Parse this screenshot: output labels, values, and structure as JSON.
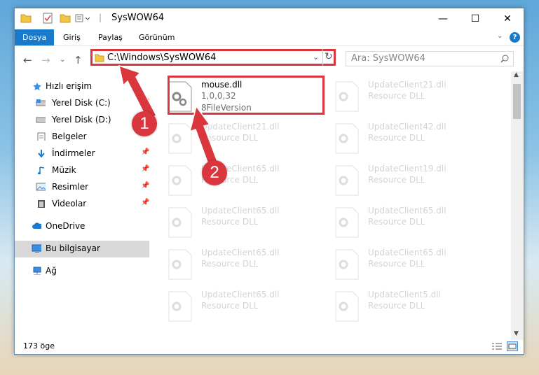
{
  "window": {
    "title": "SysWOW64",
    "controls": [
      "—",
      "☐",
      "✕"
    ]
  },
  "ribbon": {
    "tabs": [
      {
        "label": "Dosya",
        "active": true
      },
      {
        "label": "Giriş",
        "active": false
      },
      {
        "label": "Paylaş",
        "active": false
      },
      {
        "label": "Görünüm",
        "active": false
      }
    ],
    "help_icon": "help-icon"
  },
  "nav": {
    "address": "C:\\Windows\\SysWOW64",
    "search_placeholder": "Ara: SysWOW64"
  },
  "sidebar": {
    "items": [
      {
        "label": "Hızlı erişim",
        "icon": "star-icon",
        "pinned": false
      },
      {
        "label": "Yerel Disk (C:)",
        "icon": "drive-icon",
        "pinned": true
      },
      {
        "label": "Yerel Disk (D:)",
        "icon": "drive-icon",
        "pinned": false
      },
      {
        "label": "Belgeler",
        "icon": "documents-icon",
        "pinned": false
      },
      {
        "label": "İndirmeler",
        "icon": "download-icon",
        "pinned": true
      },
      {
        "label": "Müzik",
        "icon": "music-icon",
        "pinned": true
      },
      {
        "label": "Resimler",
        "icon": "pictures-icon",
        "pinned": true
      },
      {
        "label": "Videolar",
        "icon": "videos-icon",
        "pinned": true
      },
      {
        "label": "OneDrive",
        "icon": "cloud-icon",
        "pinned": false
      },
      {
        "label": "Bu bilgisayar",
        "icon": "computer-icon",
        "pinned": false,
        "selected": true
      },
      {
        "label": "Ağ",
        "icon": "network-icon",
        "pinned": false
      }
    ]
  },
  "files": [
    {
      "name": "mouse.dll",
      "type": "1,0,0,32",
      "version": "8FileVersion",
      "highlighted": true
    },
    {
      "name": "UpdateClient21.dll",
      "type": "Resource DLL"
    },
    {
      "name": "UpdateClient21.dll",
      "type": "Resource DLL"
    },
    {
      "name": "UpdateClient42.dll",
      "type": "Resource DLL"
    },
    {
      "name": "UpdateClient65.dll",
      "type": "Resource DLL"
    },
    {
      "name": "UpdateClient19.dll",
      "type": "Resource DLL"
    },
    {
      "name": "UpdateClient65.dll",
      "type": "Resource DLL"
    },
    {
      "name": "UpdateClient65.dll",
      "type": "Resource DLL"
    },
    {
      "name": "UpdateClient65.dll",
      "type": "Resource DLL"
    },
    {
      "name": "UpdateClient65.dll",
      "type": "Resource DLL"
    },
    {
      "name": "UpdateClient65.dll",
      "type": "Resource DLL"
    },
    {
      "name": "UpdateClient5.dll",
      "type": "Resource DLL"
    }
  ],
  "status": {
    "count": "173 öge"
  },
  "annotations": {
    "step1": "1",
    "step2": "2",
    "color": "#d9363e"
  }
}
